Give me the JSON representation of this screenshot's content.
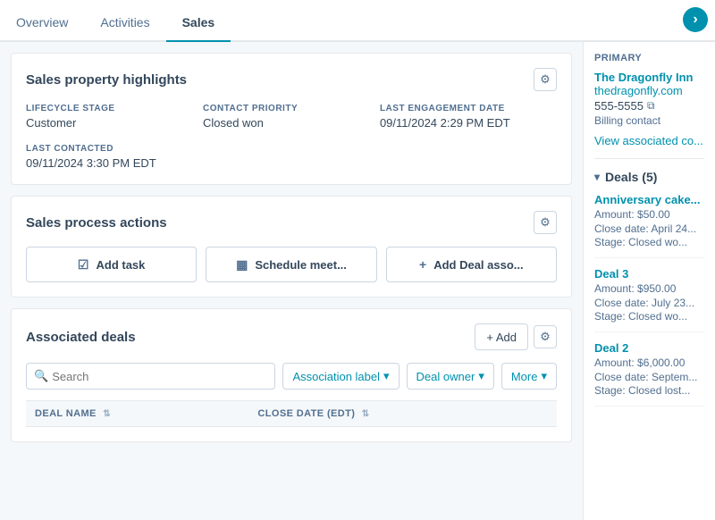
{
  "tabs": [
    {
      "id": "overview",
      "label": "Overview",
      "active": false
    },
    {
      "id": "activities",
      "label": "Activities",
      "active": false
    },
    {
      "id": "sales",
      "label": "Sales",
      "active": true
    }
  ],
  "sales_highlights": {
    "title": "Sales property highlights",
    "properties": [
      {
        "label": "LIFECYCLE STAGE",
        "value": "Customer"
      },
      {
        "label": "CONTACT PRIORITY",
        "value": "Closed won"
      },
      {
        "label": "LAST ENGAGEMENT DATE",
        "value": "09/11/2024 2:29 PM EDT"
      },
      {
        "label": "LAST CONTACTED",
        "value": "09/11/2024 3:30 PM EDT"
      }
    ]
  },
  "sales_actions": {
    "title": "Sales process actions",
    "buttons": [
      {
        "id": "add-task",
        "icon": "☑",
        "label": "Add task"
      },
      {
        "id": "schedule-meeting",
        "icon": "📅",
        "label": "Schedule meet..."
      },
      {
        "id": "add-deal",
        "icon": "+",
        "label": "Add Deal asso..."
      }
    ]
  },
  "associated_deals": {
    "title": "Associated deals",
    "add_label": "+ Add",
    "search_placeholder": "Search",
    "filters": [
      {
        "id": "association-label",
        "label": "Association label",
        "has_dropdown": true
      },
      {
        "id": "deal-owner",
        "label": "Deal owner",
        "has_dropdown": true
      },
      {
        "id": "more",
        "label": "More",
        "has_dropdown": true
      }
    ],
    "columns": [
      {
        "id": "deal-name",
        "label": "DEAL NAME"
      },
      {
        "id": "close-date",
        "label": "CLOSE DATE (EDT)"
      }
    ]
  },
  "right_panel": {
    "label": "Primary",
    "company_name": "The Dragonfly Inn",
    "company_url": "thedragonfly.com",
    "phone": "555-5555",
    "billing_contact": "Billing contact",
    "view_associated": "View associated co...",
    "deals_section": {
      "title": "Deals (5)",
      "deals": [
        {
          "name": "Anniversary cake...",
          "amount": "Amount: $50.00",
          "close_date": "Close date: April 24...",
          "stage": "Stage: Closed wo..."
        },
        {
          "name": "Deal 3",
          "amount": "Amount: $950.00",
          "close_date": "Close date: July 23...",
          "stage": "Stage: Closed wo..."
        },
        {
          "name": "Deal 2",
          "amount": "Amount: $6,000.00",
          "close_date": "Close date: Septem...",
          "stage": "Stage: Closed lost..."
        }
      ]
    }
  }
}
